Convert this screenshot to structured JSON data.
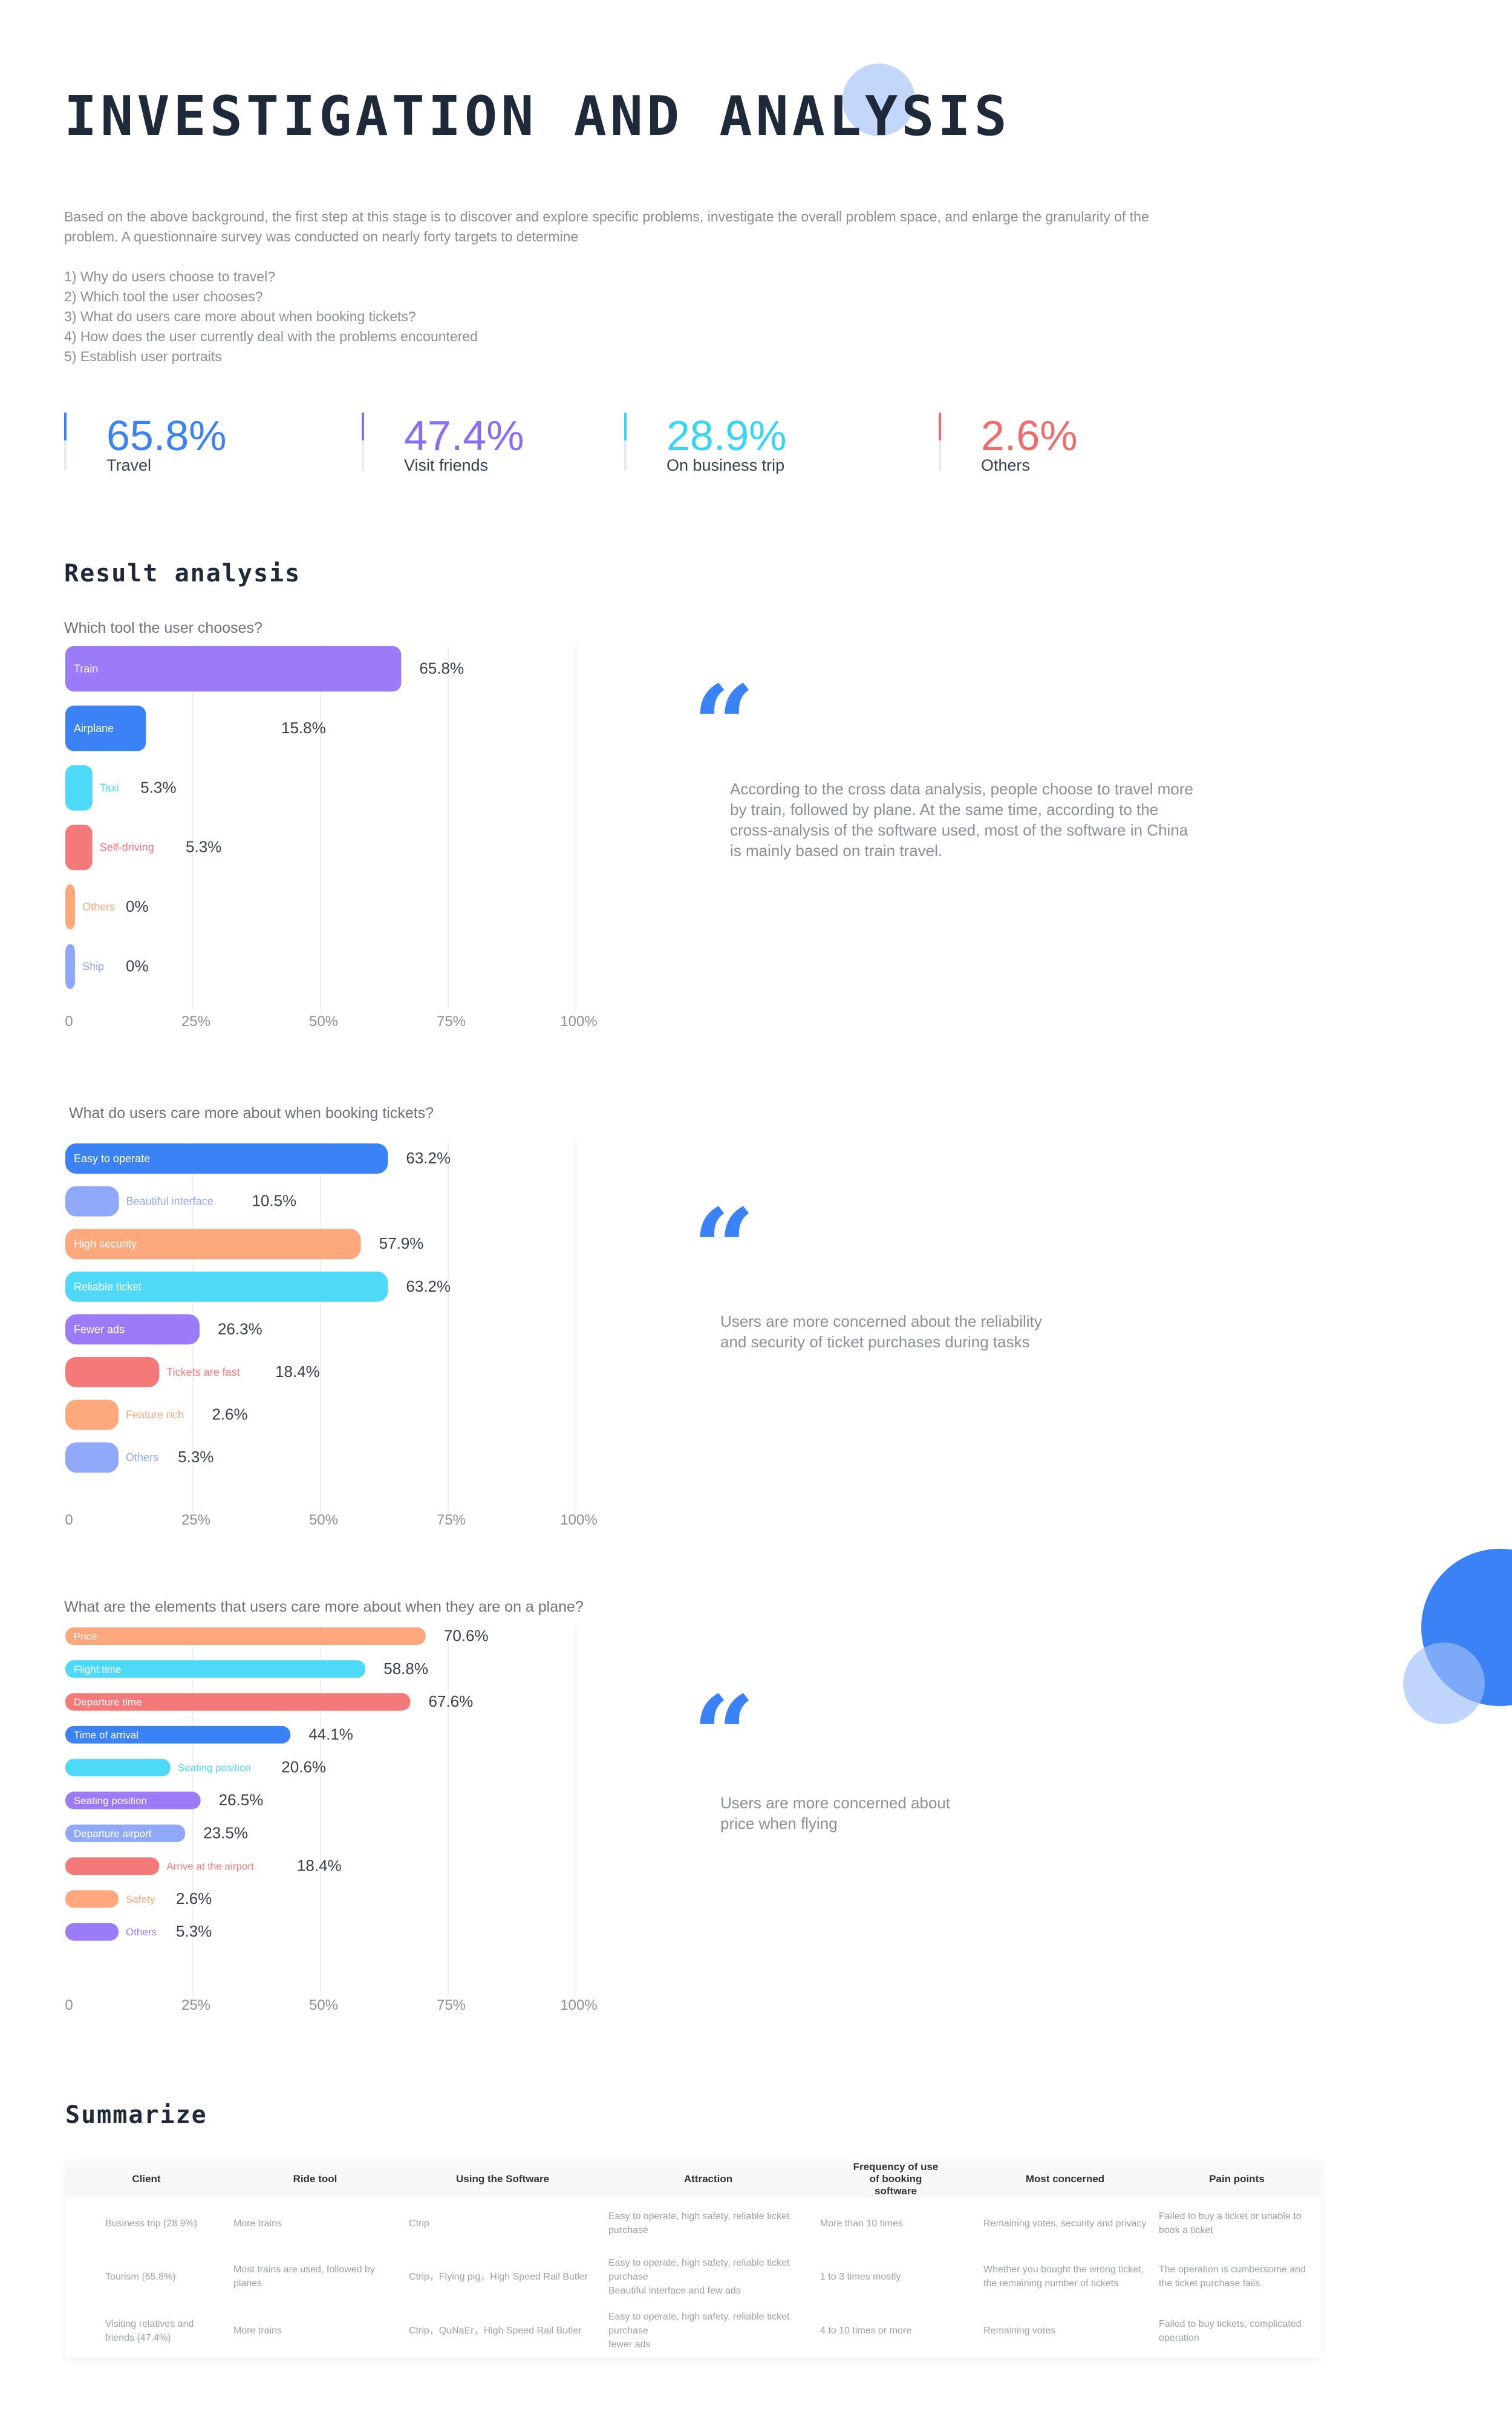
{
  "title": "INVESTIGATION AND ANALYSIS",
  "intro": {
    "paragraph": "Based on the above background, the first step at this stage is to discover and explore specific problems, investigate the overall problem space, and enlarge the granularity of the problem. A questionnaire survey was conducted on nearly forty targets to determine",
    "items": [
      "1) Why do users choose to travel?",
      "2) Which tool the user chooses?",
      "3) What do users care more about when booking tickets?",
      "4) How does the user currently deal with the problems encountered",
      "5) Establish user portraits"
    ]
  },
  "stats": [
    {
      "value": "65.8%",
      "label": "Travel",
      "color": "#3b82f6"
    },
    {
      "value": "47.4%",
      "label": "Visit friends",
      "color": "#8b6cf6"
    },
    {
      "value": "28.9%",
      "label": "On business trip",
      "color": "#38d4f5"
    },
    {
      "value": "2.6%",
      "label": "Others",
      "color": "#f26b6b"
    }
  ],
  "result_heading": "Result analysis",
  "summary_heading": "Summarize",
  "quotes": [
    "According to the cross data analysis, people choose to travel more by train, followed by plane. At the same time, according to the cross-analysis of the software used, most of the software in China is mainly based on train travel.",
    "Users are more concerned about the reliability and security of ticket purchases during tasks",
    "Users are more concerned about price when flying"
  ],
  "chart_data": [
    {
      "type": "bar",
      "title": "Which tool the user chooses?",
      "xlim": [
        0,
        100
      ],
      "ticks": [
        "0",
        "25%",
        "50%",
        "75%",
        "100%"
      ],
      "categories": [
        "Train",
        "Airplane",
        "Taxi",
        "Self-driving",
        "Others",
        "Ship"
      ],
      "values": [
        65.8,
        15.8,
        5.3,
        5.3,
        0,
        0
      ],
      "labels": [
        "65.8%",
        "15.8%",
        "5.3%",
        "5.3%",
        "0%",
        "0%"
      ],
      "colors": [
        "#9b7bf7",
        "#3b82f6",
        "#4dd9f7",
        "#f47a7a",
        "#fda77c",
        "#8fa9f8"
      ]
    },
    {
      "type": "bar",
      "title": "What do users care more about when booking tickets?",
      "xlim": [
        0,
        100
      ],
      "ticks": [
        "0",
        "25%",
        "50%",
        "75%",
        "100%"
      ],
      "categories": [
        "Easy to operate",
        "Beautiful interface",
        "High security",
        "Reliable ticket",
        "Fewer ads",
        "Tickets are fast",
        "Feature rich",
        "Others"
      ],
      "values": [
        63.2,
        10.5,
        57.9,
        63.2,
        26.3,
        18.4,
        2.6,
        5.3
      ],
      "labels": [
        "63.2%",
        "10.5%",
        "57.9%",
        "63.2%",
        "26.3%",
        "18.4%",
        "2.6%",
        "5.3%"
      ],
      "colors": [
        "#3b82f6",
        "#8fa9f8",
        "#fda77c",
        "#4dd9f7",
        "#9b7bf7",
        "#f47a7a",
        "#fda77c",
        "#8fa9f8"
      ]
    },
    {
      "type": "bar",
      "title": "What are the elements that users care more about when they are on a plane?",
      "xlim": [
        0,
        100
      ],
      "ticks": [
        "0",
        "25%",
        "50%",
        "75%",
        "100%"
      ],
      "categories": [
        "Price",
        "Flight time",
        "Departure time",
        "Time of arrival",
        "Seating position",
        "Seating position",
        "Departure airport",
        "Arrive at the airport",
        "Safety",
        "Others"
      ],
      "values": [
        70.6,
        58.8,
        67.6,
        44.1,
        20.6,
        26.5,
        23.5,
        18.4,
        2.6,
        5.3
      ],
      "labels": [
        "70.6%",
        "58.8%",
        "67.6%",
        "44.1%",
        "20.6%",
        "26.5%",
        "23.5%",
        "18.4%",
        "2.6%",
        "5.3%"
      ],
      "colors": [
        "#fda77c",
        "#4dd9f7",
        "#f47a7a",
        "#3b82f6",
        "#4dd9f7",
        "#9b7bf7",
        "#8fa9f8",
        "#f47a7a",
        "#fda77c",
        "#9b7bf7"
      ]
    }
  ],
  "table": {
    "headers": [
      "Client",
      "Ride tool",
      "Using the Software",
      "Attraction",
      "Frequency of use of booking software",
      "Most concerned",
      "Pain points"
    ],
    "rows": [
      [
        "Business trip (28.9%)",
        "More trains",
        "Ctrip",
        "Easy to operate, high safety, reliable ticket purchase",
        "More than 10 times",
        "Remaining votes, security and privacy",
        "Failed to buy a ticket or unable to book a ticket"
      ],
      [
        "Tourism (65.8%)",
        "Most trains are used, followed by planes",
        "Ctrip，Flying pig，High Speed Rail Butler",
        "Easy to operate, high safety, reliable ticket purchase\nBeautiful interface and few ads",
        "1 to 3 times mostly",
        "Whether you bought the wrong ticket, the remaining number of tickets",
        "The operation is cumbersome and the ticket purchase fails"
      ],
      [
        "Visiting relatives and friends (47.4%)",
        "More trains",
        "Ctrip，QuNaEr，High Speed Rail Butler",
        "Easy to operate, high safety, reliable ticket purchase\nfewer ads",
        "4 to 10 times or more",
        "Remaining votes",
        "Failed to buy tickets, complicated operation"
      ]
    ]
  }
}
